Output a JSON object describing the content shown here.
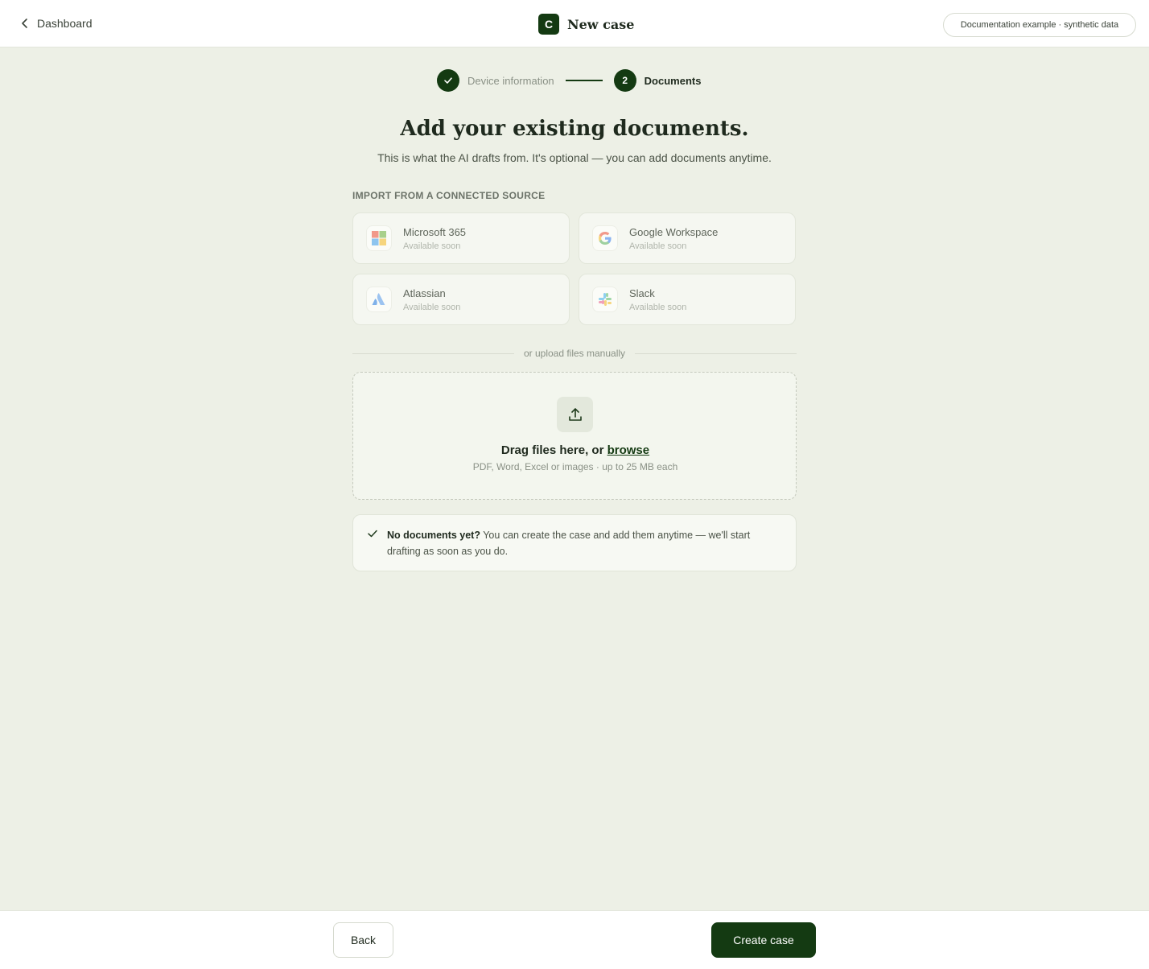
{
  "header": {
    "back_label": "Dashboard",
    "brand_letter": "C",
    "title": "New case",
    "badge": "Documentation example · synthetic data"
  },
  "stepper": {
    "steps": [
      {
        "label": "Device information",
        "state": "complete"
      },
      {
        "number": "2",
        "label": "Documents",
        "state": "active"
      }
    ]
  },
  "main": {
    "heading": "Add your existing documents.",
    "subheading": "This is what the AI drafts from. It's optional — you can add documents anytime.",
    "section_label": "IMPORT FROM A CONNECTED SOURCE",
    "sources": [
      {
        "name": "Microsoft 365",
        "status": "Available soon",
        "icon": "microsoft-icon"
      },
      {
        "name": "Google Workspace",
        "status": "Available soon",
        "icon": "google-icon"
      },
      {
        "name": "Atlassian",
        "status": "Available soon",
        "icon": "atlassian-icon"
      },
      {
        "name": "Slack",
        "status": "Available soon",
        "icon": "slack-icon"
      }
    ],
    "divider_text": "or upload files manually",
    "dropzone": {
      "title": "Drag files here, or",
      "browse": "browse",
      "hint": "PDF, Word, Excel or images · up to 25 MB each"
    },
    "note": {
      "strong": "No documents yet?",
      "text": " You can create the case and add them anytime — we'll start drafting as soon as you do."
    }
  },
  "footer": {
    "back": "Back",
    "create": "Create case"
  },
  "colors": {
    "brand": "#143a12",
    "background": "#edf0e6"
  }
}
